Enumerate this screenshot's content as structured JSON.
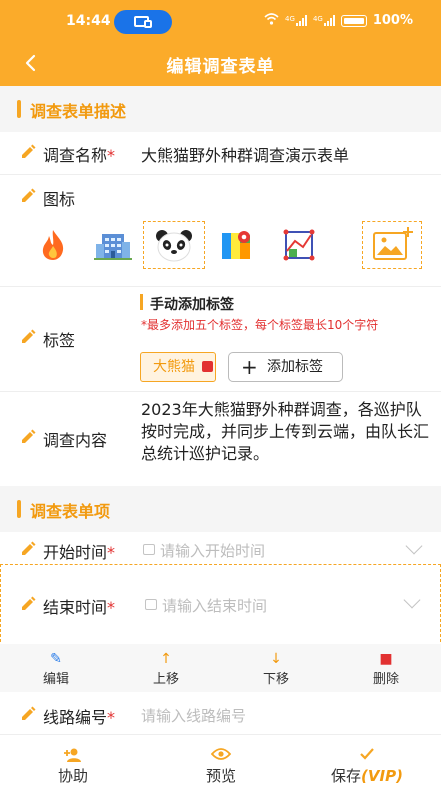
{
  "status_bar": {
    "time": "14:44",
    "battery": "100%",
    "network_labels": [
      "4G",
      "4G"
    ]
  },
  "nav": {
    "title": "编辑调查表单"
  },
  "section1": {
    "title": "调查表单描述"
  },
  "form_name": {
    "label": "调查名称",
    "required_mark": "*",
    "value": "大熊猫野外种群调查演示表单"
  },
  "icon_field": {
    "label": "图标",
    "options": [
      "fire-icon",
      "building-icon",
      "panda-icon",
      "map-icon",
      "chart-icon"
    ],
    "selected": "panda-icon",
    "add_icon": "add-image-icon"
  },
  "tags": {
    "label": "标签",
    "mode_title": "手动添加标签",
    "hint": "*最多添加五个标签，每个标签最长10个字符",
    "chips": [
      "大熊猫"
    ],
    "add_label": "添加标签"
  },
  "survey_content": {
    "label": "调查内容",
    "value": "2023年大熊猫野外种群调查，各巡护队按时完成，并同步上传到云端，由队长汇总统计巡护记录。"
  },
  "section2": {
    "title": "调查表单项"
  },
  "items": [
    {
      "label": "开始时间",
      "required_mark": "*",
      "placeholder": "请输入开始时间"
    },
    {
      "label": "结束时间",
      "required_mark": "*",
      "placeholder": "请输入结束时间"
    },
    {
      "label": "线路编号",
      "required_mark": "*",
      "placeholder": "请输入线路编号"
    }
  ],
  "item_toolbar": {
    "edit": "编辑",
    "up": "上移",
    "down": "下移",
    "delete": "删除"
  },
  "bottom_bar": {
    "assist": "协助",
    "preview": "预览",
    "save": "保存",
    "save_badge": "(VIP)"
  },
  "colors": {
    "accent": "#fbab2a",
    "accent_text": "#f29a0f",
    "required": "#e23131",
    "placeholder": "#bdbdbd"
  }
}
